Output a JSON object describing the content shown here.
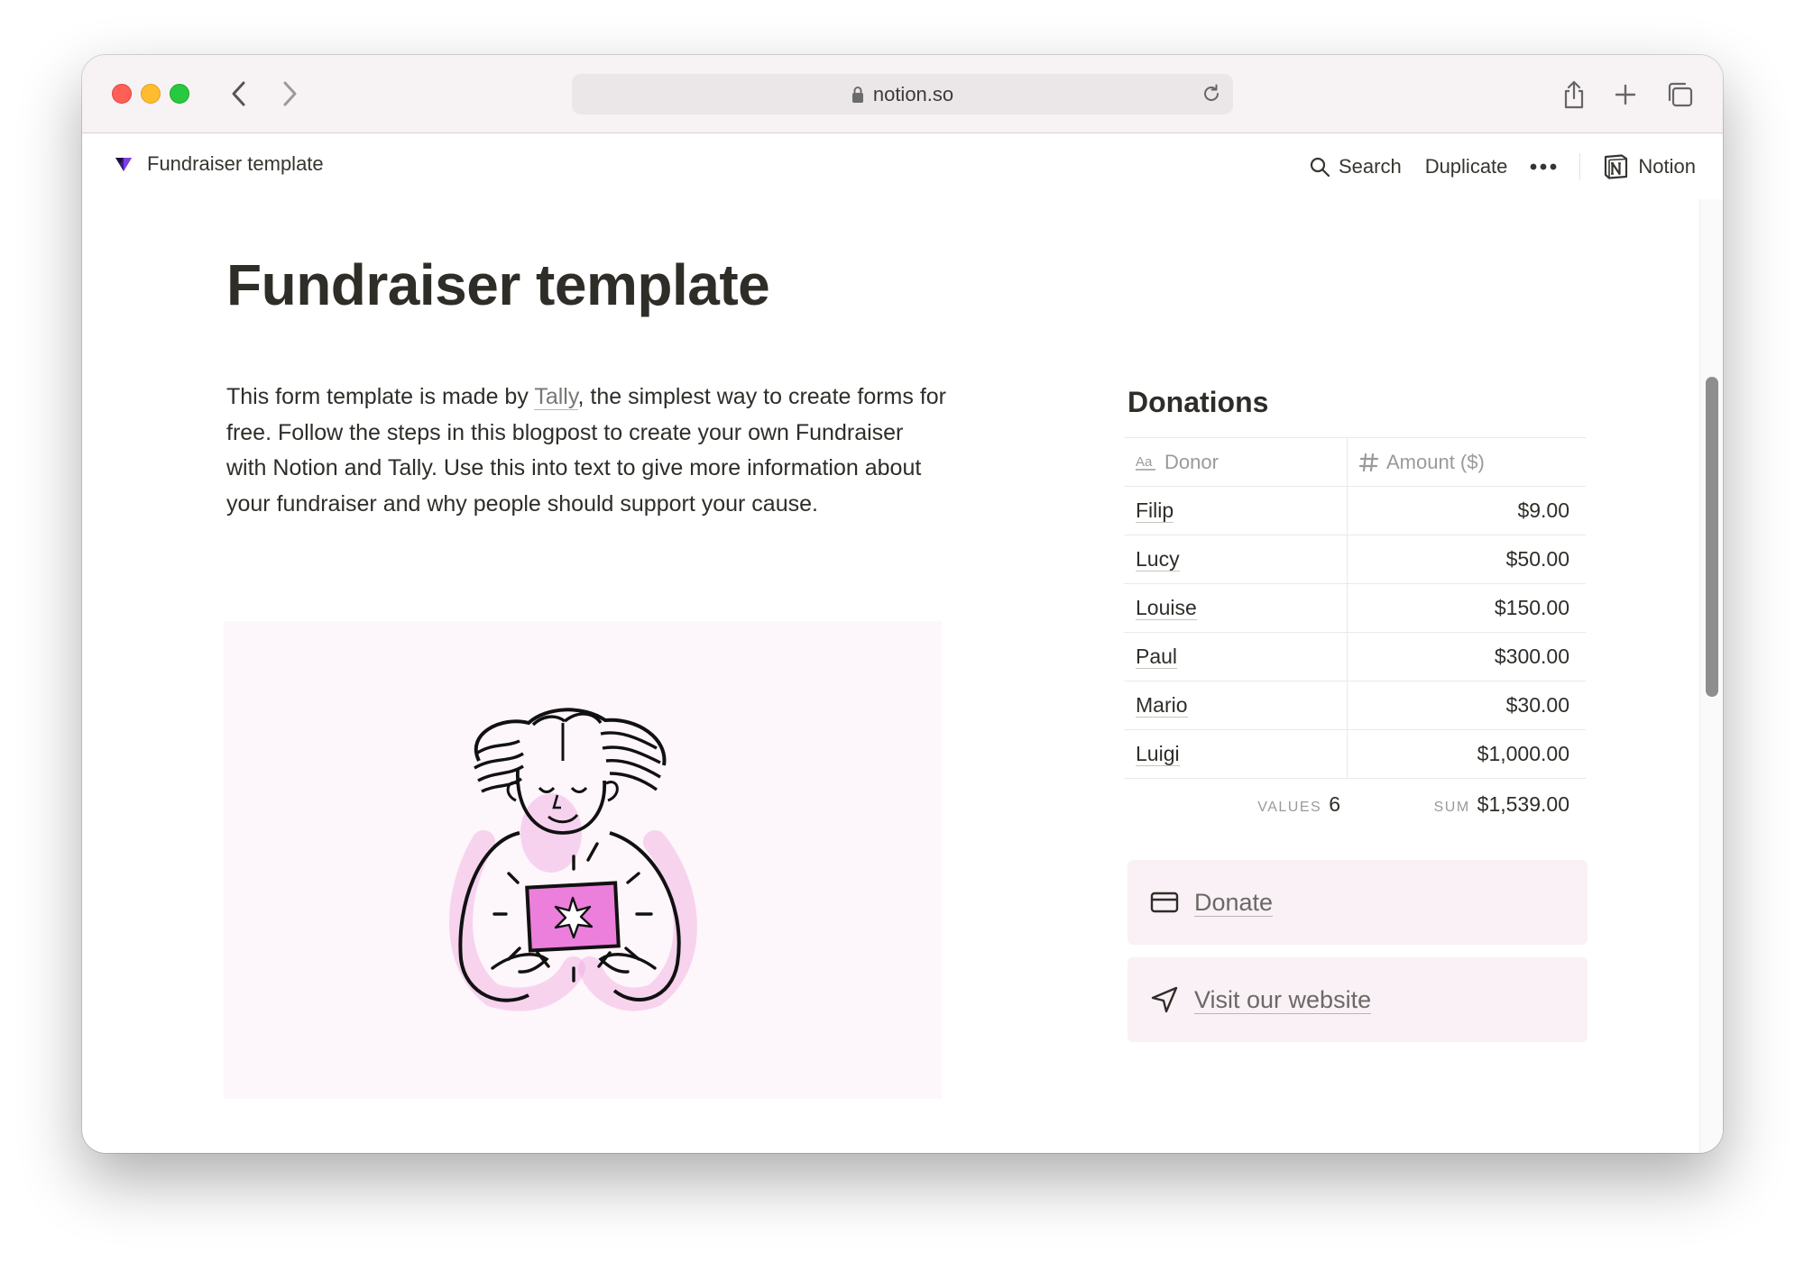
{
  "browser": {
    "url": "notion.so"
  },
  "topbar": {
    "page_title": "Fundraiser template",
    "search_label": "Search",
    "duplicate_label": "Duplicate",
    "brand_label": "Notion"
  },
  "page": {
    "title": "Fundraiser template",
    "intro_before": "This form template is made by ",
    "intro_link": "Tally",
    "intro_after": ", the simplest way to create forms for free. Follow the steps in this blogpost to create your own Fundraiser with Notion and Tally. Use this into text to give more information about your fundraiser and why people should support your cause."
  },
  "donations": {
    "title": "Donations",
    "columns": [
      "Donor",
      "Amount ($)"
    ],
    "rows": [
      {
        "donor": "Filip",
        "amount": "$9.00"
      },
      {
        "donor": "Lucy",
        "amount": "$50.00"
      },
      {
        "donor": "Louise",
        "amount": "$150.00"
      },
      {
        "donor": "Paul",
        "amount": "$300.00"
      },
      {
        "donor": "Mario",
        "amount": "$30.00"
      },
      {
        "donor": "Luigi",
        "amount": "$1,000.00"
      }
    ],
    "footer": {
      "values_label": "VALUES",
      "values_count": "6",
      "sum_label": "SUM",
      "sum_value": "$1,539.00"
    }
  },
  "actions": {
    "donate_label": "Donate",
    "website_label": "Visit our website"
  },
  "colors": {
    "accent_illustration": "#e66bd0",
    "callout_bg": "#f9f1f5",
    "illustration_bg": "#fdf6fa"
  }
}
